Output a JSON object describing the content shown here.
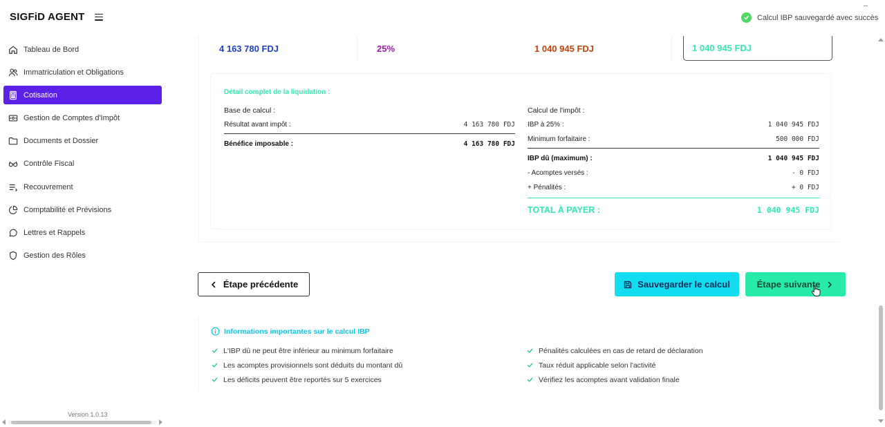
{
  "app": {
    "brand": "SIGFiD AGENT",
    "version": "Version 1.0.13"
  },
  "sidebar": {
    "items": [
      {
        "label": "Tableau de Bord",
        "icon": "home-icon"
      },
      {
        "label": "Immatriculation et Obligations",
        "icon": "users-icon"
      },
      {
        "label": "Cotisation",
        "icon": "calculator-icon",
        "active": true
      },
      {
        "label": "Gestion de Comptes d'Impôt",
        "icon": "wallet-icon"
      },
      {
        "label": "Documents et Dossier",
        "icon": "folder-icon"
      },
      {
        "label": "Contrôle Fiscal",
        "icon": "glasses-icon"
      },
      {
        "label": "Recouvrement",
        "icon": "list-icon"
      },
      {
        "label": "Comptabilité et Prévisions",
        "icon": "pie-chart-icon"
      },
      {
        "label": "Lettres et Rappels",
        "icon": "message-icon"
      },
      {
        "label": "Gestion des Rôles",
        "icon": "shield-icon"
      }
    ]
  },
  "toast": {
    "message": "Calcul IBP sauvegardé avec succès",
    "icon": "check-circle-icon"
  },
  "summary": {
    "base": "4 163 780 FDJ",
    "rate": "25%",
    "ibp": "1 040 945 FDJ",
    "total": "1 040 945 FDJ"
  },
  "detail": {
    "title": "Détail complet de la liquidation :",
    "base": {
      "heading": "Base de calcul :",
      "rows": [
        {
          "label": "Résultat avant impôt :",
          "value": "4 163 780 FDJ"
        }
      ],
      "result": {
        "label": "Bénéfice imposable :",
        "value": "4 163 780 FDJ"
      }
    },
    "calc": {
      "heading": "Calcul de l'impôt :",
      "rows": [
        {
          "label": "IBP à 25% :",
          "value": "1 040 945 FDJ"
        },
        {
          "label": "Minimum forfaitaire :",
          "value": "500 000 FDJ"
        }
      ],
      "due": {
        "label": "IBP dû (maximum) :",
        "value": "1 040 945 FDJ"
      },
      "adjustments": [
        {
          "label": "- Acomptes versés :",
          "value": "- 0 FDJ"
        },
        {
          "label": "+ Pénalités :",
          "value": "+ 0 FDJ"
        }
      ],
      "total": {
        "label": "TOTAL À PAYER :",
        "value": "1 040 945 FDJ"
      }
    }
  },
  "buttons": {
    "prev": "Étape précédente",
    "save": "Sauvegarder le calcul",
    "next": "Étape suivante"
  },
  "info": {
    "title": "Informations importantes sur le calcul IBP",
    "left": [
      "L'IBP dû ne peut être inférieur au minimum forfaitaire",
      "Les acomptes provisionnels sont déduits du montant dû",
      "Les déficits peuvent être reportés sur 5 exercices"
    ],
    "right": [
      "Pénalités calculées en cas de retard de déclaration",
      "Taux réduit applicable selon l'activité",
      "Vérifiez les acomptes avant validation finale"
    ]
  },
  "colors": {
    "accent": "#5b21e6",
    "teal": "#34e8b4",
    "cyan": "#11dcf0",
    "green": "#27eba6",
    "blue": "#1e40c8",
    "purple": "#a21caf",
    "orange": "#c2410c"
  }
}
